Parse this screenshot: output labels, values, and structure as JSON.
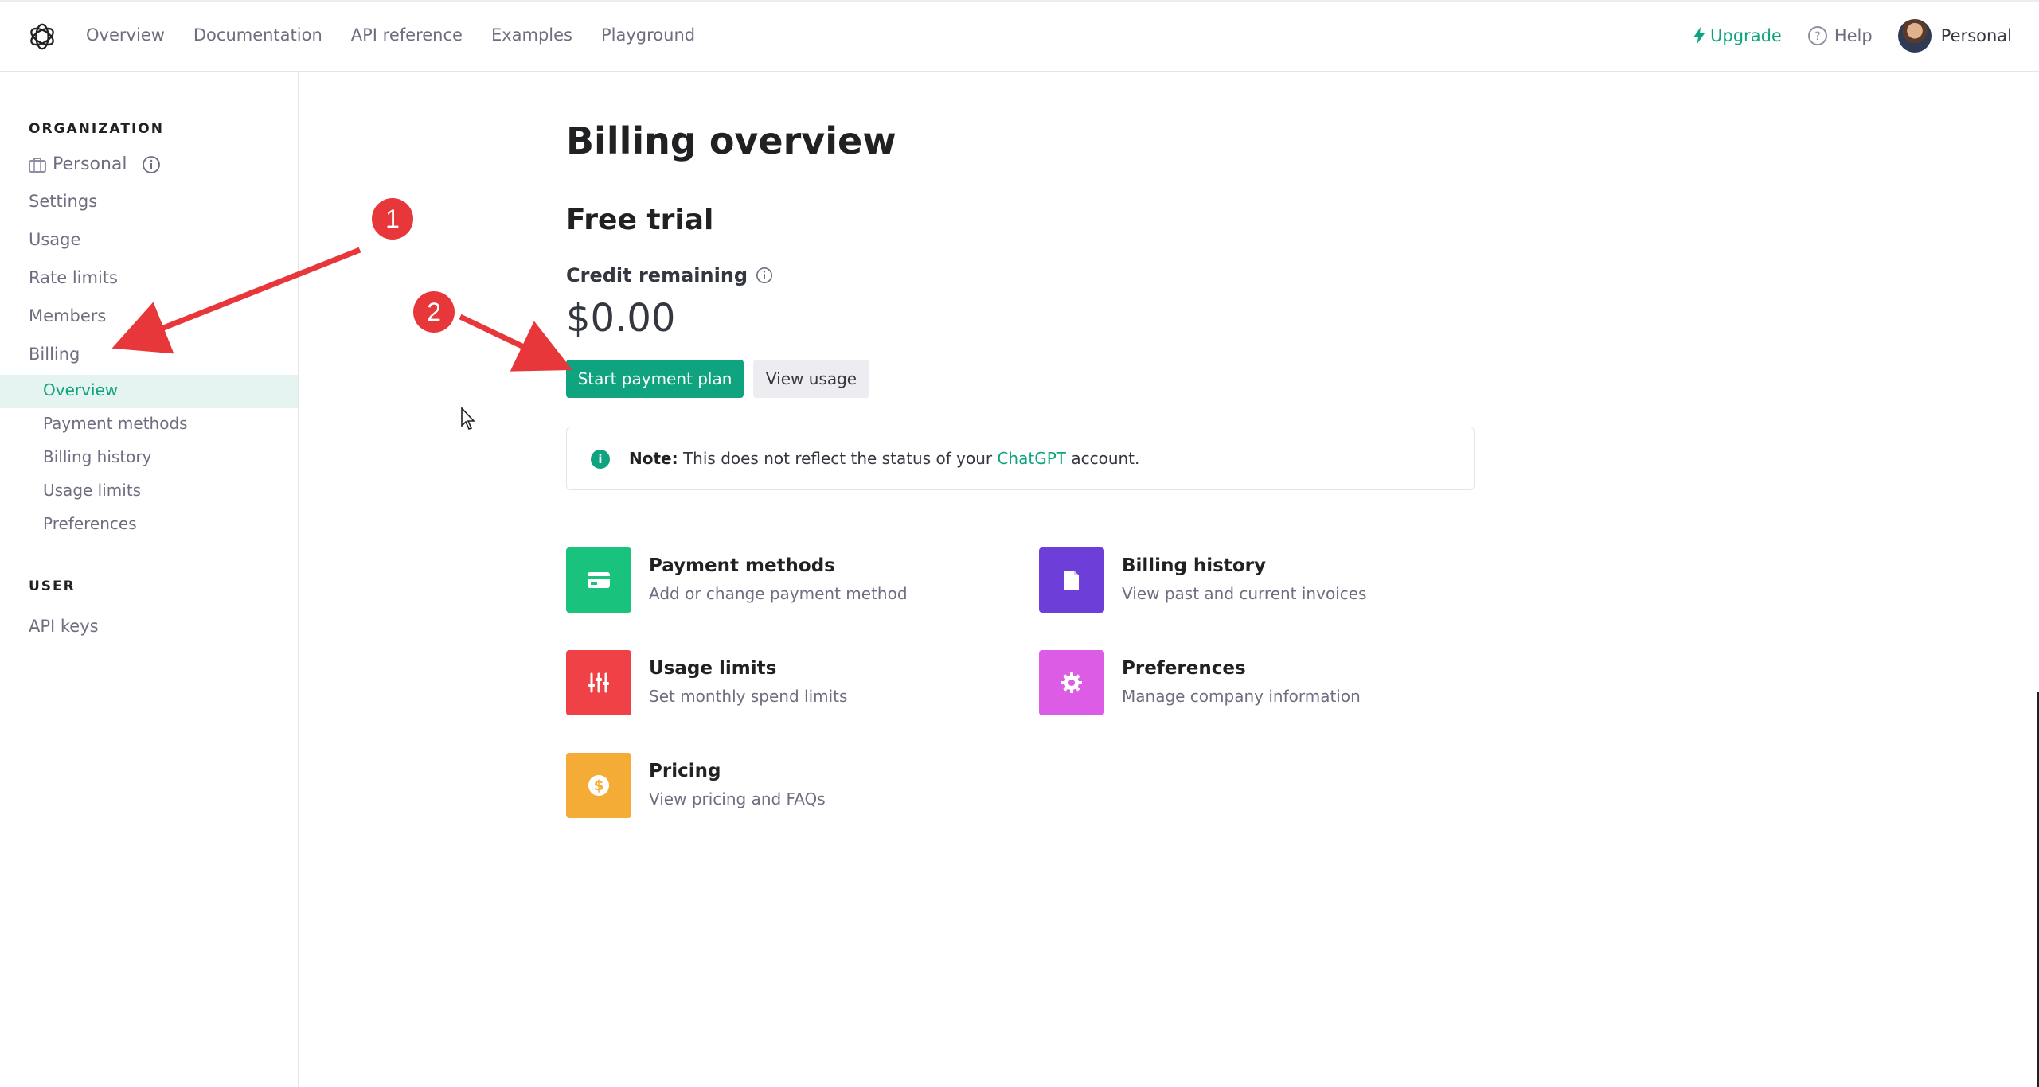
{
  "topnav": {
    "items": [
      "Overview",
      "Documentation",
      "API reference",
      "Examples",
      "Playground"
    ],
    "upgrade": "Upgrade",
    "help": "Help",
    "account": "Personal"
  },
  "sidebar": {
    "org_title": "ORGANIZATION",
    "org_name": "Personal",
    "items": [
      "Settings",
      "Usage",
      "Rate limits",
      "Members",
      "Billing"
    ],
    "billing_sub": [
      "Overview",
      "Payment methods",
      "Billing history",
      "Usage limits",
      "Preferences"
    ],
    "user_title": "USER",
    "user_items": [
      "API keys"
    ]
  },
  "main": {
    "title": "Billing overview",
    "plan": "Free trial",
    "credit_label": "Credit remaining",
    "credit_amount": "$0.00",
    "primary_button": "Start payment plan",
    "secondary_button": "View usage",
    "note": {
      "label": "Note:",
      "text_before": "This does not reflect the status of your",
      "link": "ChatGPT",
      "text_after": "account."
    },
    "cards": [
      {
        "title": "Payment methods",
        "desc": "Add or change payment method",
        "color": "#19c37d"
      },
      {
        "title": "Billing history",
        "desc": "View past and current invoices",
        "color": "#6e3ed8"
      },
      {
        "title": "Usage limits",
        "desc": "Set monthly spend limits",
        "color": "#ef4146"
      },
      {
        "title": "Preferences",
        "desc": "Manage company information",
        "color": "#dd5ce5"
      },
      {
        "title": "Pricing",
        "desc": "View pricing and FAQs",
        "color": "#f4ac36"
      }
    ]
  },
  "annotations": {
    "badge1": "1",
    "badge2": "2",
    "color": "#e8373b"
  }
}
